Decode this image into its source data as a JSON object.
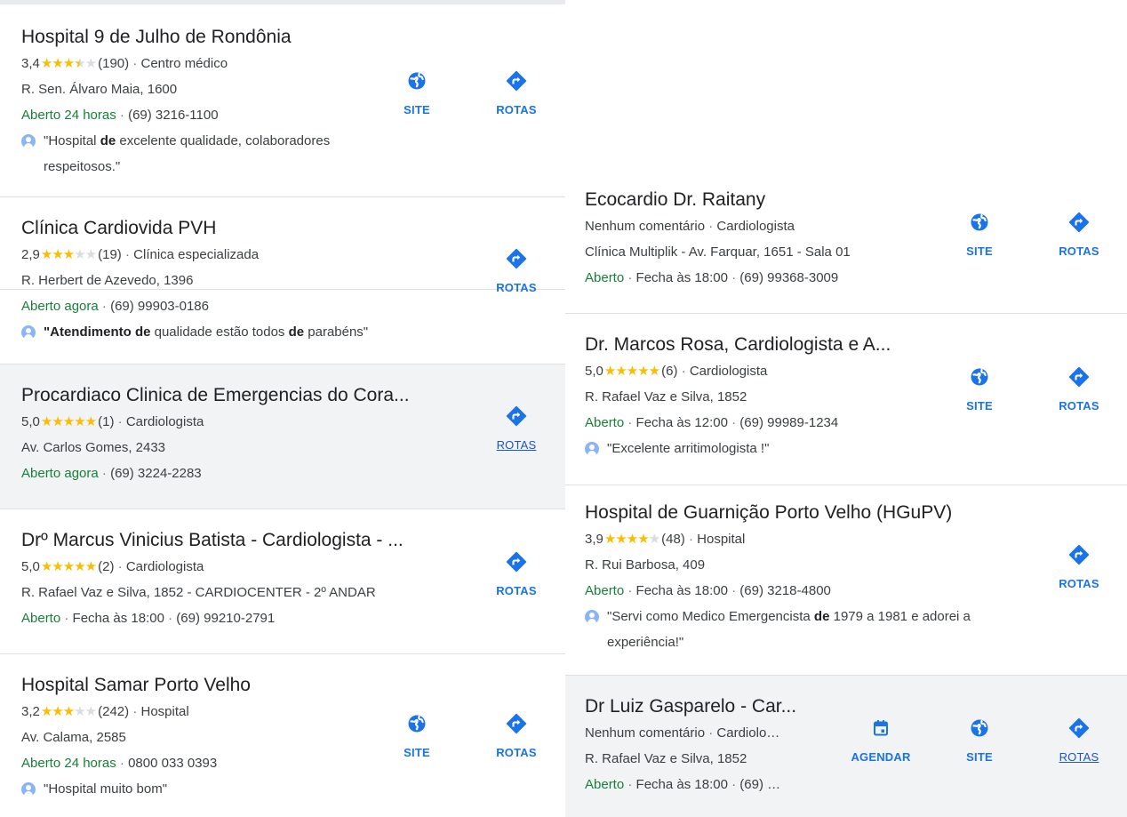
{
  "actions": {
    "site": "SITE",
    "routes": "ROTAS",
    "schedule": "AGENDAR"
  },
  "icons": {
    "site": "globe-icon",
    "routes": "directions-icon",
    "schedule": "calendar-icon",
    "reviewer": "avatar-icon"
  },
  "colors": {
    "accent": "#1a73e8",
    "open": "#188038",
    "star": "#fbbc04",
    "highlight": "#f1f3f4"
  },
  "left": [
    {
      "name": "Hospital 9 de Julho de Rondônia",
      "rating": "3,4",
      "stars": 3.5,
      "reviews": "(190)",
      "category": "Centro médico",
      "address": "R. Sen. Álvaro Maia, 1600",
      "status": "Aberto 24 horas",
      "extra": "",
      "phone": "(69) 3216-1100",
      "quote": {
        "a": "\"Hospital ",
        "b": "de",
        "c": " excelente qualidade, colaboradores respeitosos.\""
      }
    },
    {
      "name": "Clínica Cardiovida PVH",
      "rating": "2,9",
      "stars": 3,
      "reviews": "(19)",
      "category": "Clínica especializada",
      "address": "R. Herbert de Azevedo, 1396",
      "status": "Aberto agora",
      "extra": "",
      "phone": "(69) 99903-0186",
      "quote": {
        "b1": "\"Atendimento de",
        "t1": " qualidade estão todos ",
        "b2": "de",
        "t2": " parabéns\""
      }
    },
    {
      "name": "Procardiaco Clinica de Emergencias do Cora...",
      "rating": "5,0",
      "stars": 5,
      "reviews": "(1)",
      "category": "Cardiologista",
      "address": "Av. Carlos Gomes, 2433",
      "status": "Aberto agora",
      "extra": "",
      "phone": "(69) 3224-2283"
    },
    {
      "name": "Drº Marcus Vinicius Batista - Cardiologista - ...",
      "rating": "5,0",
      "stars": 5,
      "reviews": "(2)",
      "category": "Cardiologista",
      "address": "R. Rafael Vaz e Silva, 1852 - CARDIOCENTER - 2º ANDAR",
      "status": "Aberto",
      "extra": "Fecha às 18:00",
      "phone": "(69) 99210-2791"
    },
    {
      "name": "Hospital Samar Porto Velho",
      "rating": "3,2",
      "stars": 3,
      "reviews": "(242)",
      "category": "Hospital",
      "address": "Av. Calama, 2585",
      "status": "Aberto 24 horas",
      "extra": "",
      "phone": "0800 033 0393",
      "quote": {
        "a": "\"Hospital muito bom\""
      }
    }
  ],
  "right": [
    {
      "name": "Ecocardio Dr. Raitany",
      "no_reviews": "Nenhum comentário",
      "category": "Cardiologista",
      "address": "Clínica Multiplik - Av. Farquar, 1651 - Sala 01",
      "status": "Aberto",
      "extra": "Fecha às 18:00",
      "phone": "(69) 99368-3009"
    },
    {
      "name": "Dr. Marcos Rosa, Cardiologista e A...",
      "rating": "5,0",
      "stars": 5,
      "reviews": "(6)",
      "category": "Cardiologista",
      "address": "R. Rafael Vaz e Silva, 1852",
      "status": "Aberto",
      "extra": "Fecha às 12:00",
      "phone": "(69) 99989-1234",
      "quote": {
        "a": "\"Excelente arritimologista !\""
      }
    },
    {
      "name": "Hospital de Guarnição Porto Velho (HGuPV)",
      "rating": "3,9",
      "stars": 4,
      "reviews": "(48)",
      "category": "Hospital",
      "address": "R. Rui Barbosa, 409",
      "status": "Aberto",
      "extra": "Fecha às 18:00",
      "phone": "(69) 3218-4800",
      "quote": {
        "a": "\"Servi como Medico Emergencista ",
        "b": "de",
        "c": " 1979 a 1981 e adorei a experiência!\""
      }
    },
    {
      "name": "Dr Luiz Gasparelo - Car...",
      "no_reviews": "Nenhum comentário",
      "category": "Cardiolo…",
      "address": "R. Rafael Vaz e Silva, 1852",
      "status": "Aberto",
      "extra": "Fecha às 18:00",
      "phone": "(69) …"
    }
  ]
}
